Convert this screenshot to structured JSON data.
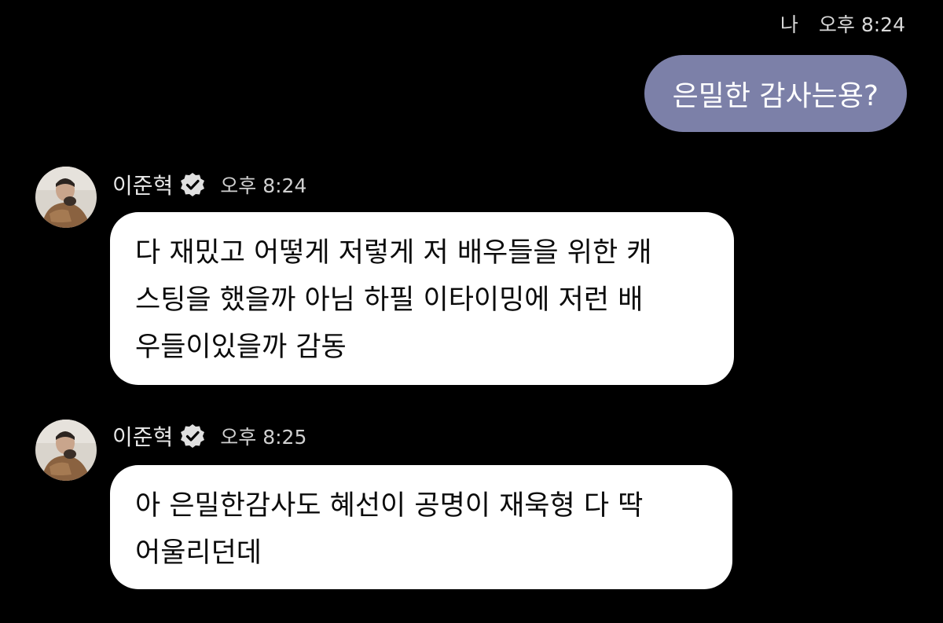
{
  "outgoing": {
    "sender_label": "나",
    "time": "오후 8:24",
    "text": "은밀한 감사는용?",
    "bubble_color": "#7c80a8"
  },
  "incoming": [
    {
      "sender": "이준혁",
      "verified_icon": "verified-badge-icon",
      "time": "오후 8:24",
      "lines": [
        "다 재밌고 어떻게 저렇게 저 배우들을 위한 캐",
        "스팅을 했을까 아님 하필 이타이밍에 저런 배",
        "우들이있을까 감동"
      ]
    },
    {
      "sender": "이준혁",
      "verified_icon": "verified-badge-icon",
      "time": "오후 8:25",
      "lines": [
        "아 은밀한감사도 혜선이 공명이 재욱형 다 딱",
        "어울리던데"
      ]
    }
  ],
  "colors": {
    "background": "#000000",
    "incoming_bubble": "#ffffff",
    "outgoing_bubble": "#7c80a8"
  }
}
